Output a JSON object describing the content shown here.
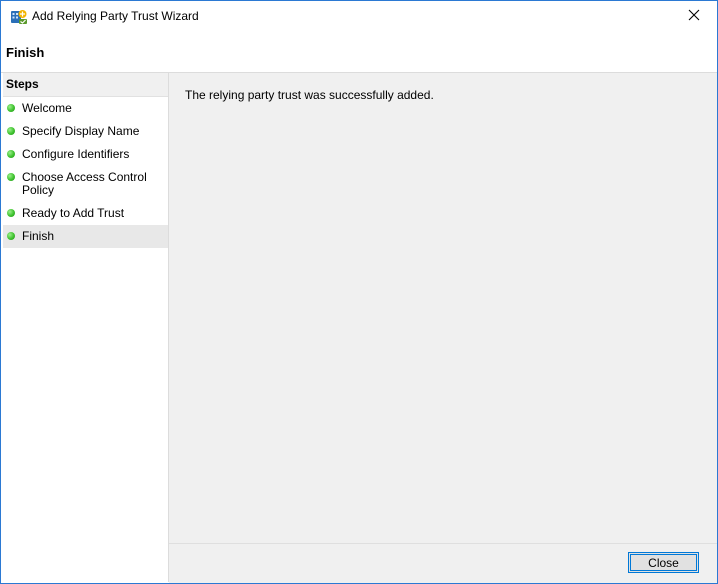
{
  "window": {
    "title": "Add Relying Party Trust Wizard",
    "app_icon": "relying-party-trust-icon",
    "close_icon": "close-icon",
    "close_glyph": "✕"
  },
  "page": {
    "title": "Finish"
  },
  "steps": {
    "heading": "Steps",
    "items": [
      {
        "label": "Welcome",
        "status": "complete"
      },
      {
        "label": "Specify Display Name",
        "status": "complete"
      },
      {
        "label": "Configure Identifiers",
        "status": "complete"
      },
      {
        "label": "Choose Access Control Policy",
        "status": "complete"
      },
      {
        "label": "Ready to Add Trust",
        "status": "complete"
      },
      {
        "label": "Finish",
        "status": "current"
      }
    ]
  },
  "content": {
    "message": "The relying party trust was successfully added."
  },
  "footer": {
    "close_label": "Close"
  },
  "colors": {
    "window_border": "#2b79d3",
    "content_bg": "#f0f0f0",
    "step_dot": "#3fc22f",
    "button_focus_border": "#0078d7"
  }
}
